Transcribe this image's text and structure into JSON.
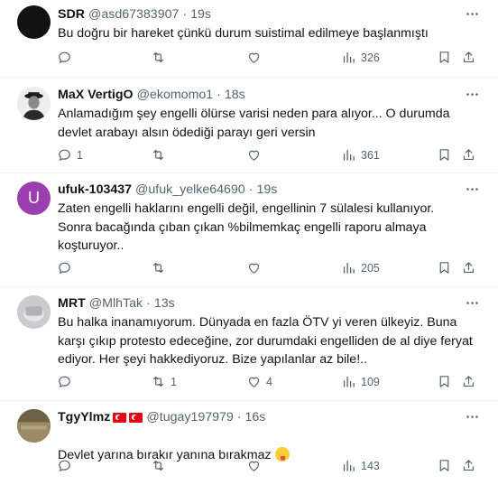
{
  "tweets": [
    {
      "name": "SDR",
      "handle": "@asd67383907",
      "sep": "·",
      "time": "19s",
      "avatar": {
        "type": "image",
        "color": "#1a1a1a"
      },
      "text": "Bu doğru bir hareket çünkü durum suistimal edilmeye başlanmıştı",
      "replies": "",
      "reposts": "",
      "likes": "",
      "views": "326"
    },
    {
      "name": "MaX VertigO",
      "handle": "@ekomomo1",
      "sep": "·",
      "time": "18s",
      "avatar": {
        "type": "image",
        "color": "#e9e9e9"
      },
      "text": "Anlamadığım şey engelli ölürse  varisi neden para alıyor...  O durumda devlet arabayı alsın ödediği parayı geri versin",
      "replies": "1",
      "reposts": "",
      "likes": "",
      "views": "361"
    },
    {
      "name": "ufuk-103437",
      "handle": "@ufuk_yelke64690",
      "sep": "·",
      "time": "19s",
      "avatar": {
        "type": "letter",
        "letter": "U",
        "color": "#9c3fae"
      },
      "text": "Zaten engelli haklarını engelli değil, engellinin 7 sülalesi kullanıyor.\nSonra bacağında çıban çıkan %bilmemkaç engelli raporu almaya koşturuyor..",
      "replies": "",
      "reposts": "",
      "likes": "",
      "views": "205"
    },
    {
      "name": "MRT",
      "handle": "@MlhTak",
      "sep": "·",
      "time": "13s",
      "avatar": {
        "type": "image",
        "color": "#c9ccce"
      },
      "text": "Bu halka inanamıyorum. Dünyada en fazla ÖTV yi veren ülkeyiz. Buna karşı çıkıp protesto edeceğine, zor durumdaki engelliden de al diye feryat ediyor. Her şeyi hakkediyoruz. Bize yapılanlar az bile!..",
      "replies": "",
      "reposts": "1",
      "likes": "4",
      "views": "109"
    },
    {
      "name": "TgyYlmz",
      "handle": "@tugay197979",
      "sep": "·",
      "time": "16s",
      "avatar": {
        "type": "image",
        "color": "#8a7a5c"
      },
      "text": "Devlet yarına bırakır yanına bırakmaz",
      "replies": "",
      "reposts": "",
      "likes": "",
      "views": "143"
    }
  ]
}
